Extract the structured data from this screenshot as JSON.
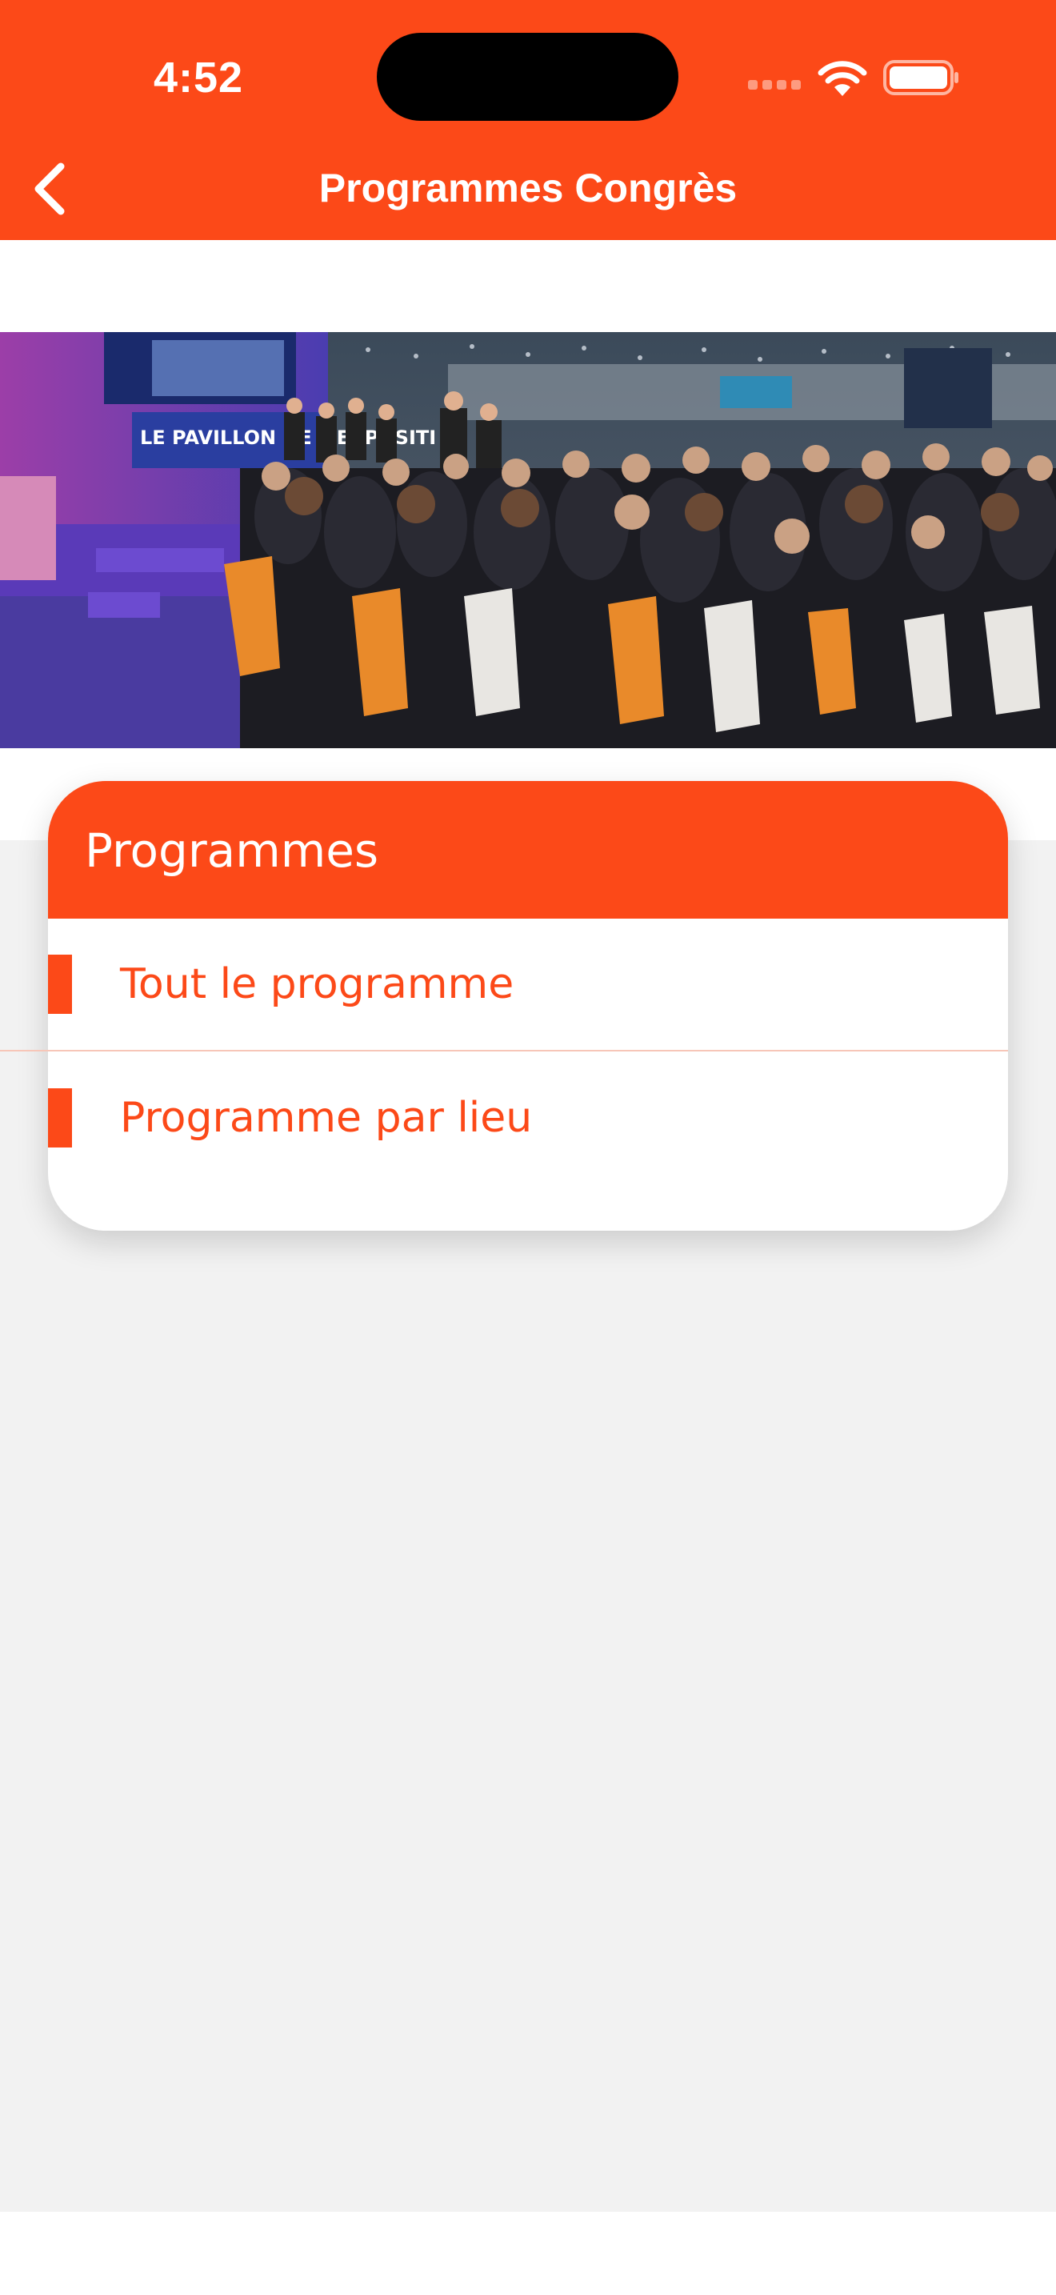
{
  "status_bar": {
    "time": "4:52"
  },
  "nav": {
    "title": "Programmes Congrès",
    "back_icon": "chevron-left-icon"
  },
  "hero": {
    "banner_text": "LE PAVILLON DE L'EXPOSITI"
  },
  "programmes_card": {
    "title": "Programmes",
    "items": [
      {
        "label": "Tout le programme"
      },
      {
        "label": "Programme par lieu"
      }
    ]
  },
  "colors": {
    "accent": "#fc4918",
    "background": "#f2f2f2",
    "card": "#ffffff"
  }
}
